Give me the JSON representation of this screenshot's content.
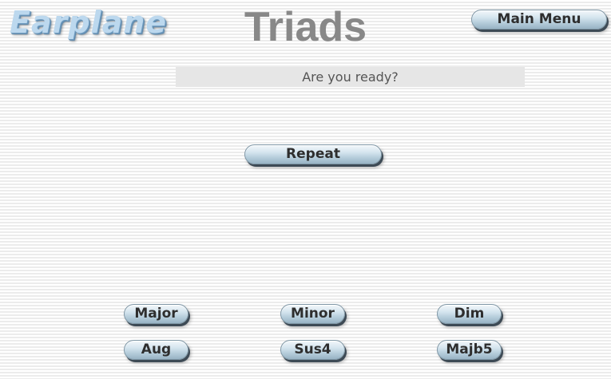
{
  "header": {
    "logo_text": "Earplane",
    "title": "Triads",
    "main_menu_label": "Main Menu"
  },
  "status": {
    "message": "Are you ready?"
  },
  "controls": {
    "repeat_label": "Repeat"
  },
  "answers": {
    "row1": [
      "Major",
      "Minor",
      "Dim"
    ],
    "row2": [
      "Aug",
      "Sus4",
      "Majb5"
    ]
  }
}
